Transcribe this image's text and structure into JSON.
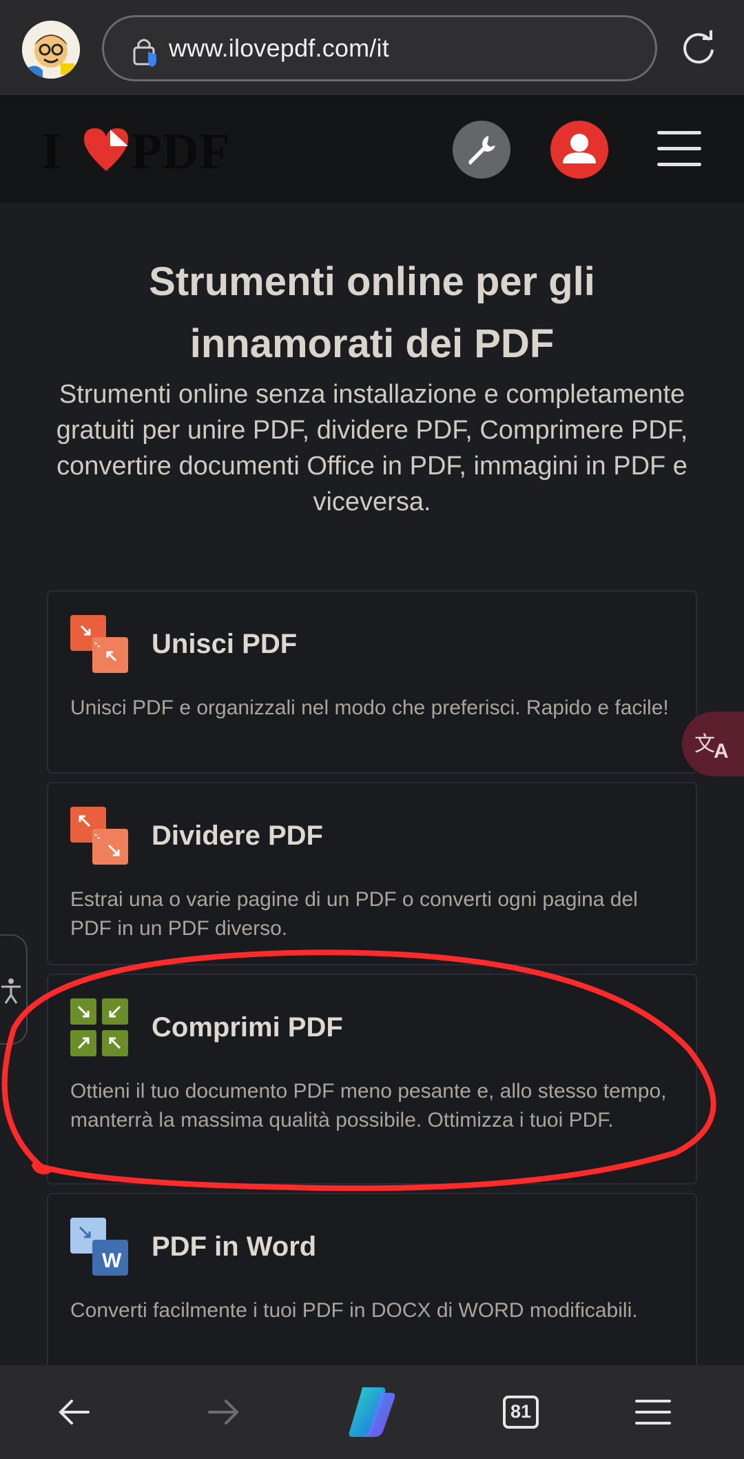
{
  "browser": {
    "url": "www.ilovepdf.com/it",
    "tab_count": "81"
  },
  "header": {
    "logo_text": "I ♥ PDF"
  },
  "hero": {
    "title_line1": "Strumenti online per gli",
    "title_line2": "innamorati dei PDF",
    "subtitle": "Strumenti online senza installazione e completamente gratuiti per unire PDF, dividere PDF, Comprimere PDF, convertire documenti Office in PDF, immagini in PDF e viceversa."
  },
  "tools": [
    {
      "title": "Unisci PDF",
      "description": "Unisci PDF e organizzali nel modo che preferisci. Rapido e facile!",
      "icon": "merge-pdf-icon",
      "color": "#e8613c"
    },
    {
      "title": "Dividere PDF",
      "description": "Estrai una o varie pagine di un PDF o converti ogni pagina del PDF in un PDF diverso.",
      "icon": "split-pdf-icon",
      "color": "#e8613c"
    },
    {
      "title": "Comprimi PDF",
      "description": "Ottieni il tuo documento PDF meno pesante e, allo stesso tempo, manterrà la massima qualità possibile. Ottimizza i tuoi PDF.",
      "icon": "compress-pdf-icon",
      "color": "#6b8e2a"
    },
    {
      "title": "PDF in Word",
      "description": "Converti facilmente i tuoi PDF in DOCX di WORD modificabili.",
      "icon": "pdf-to-word-icon",
      "color": "#3f6fb0"
    }
  ],
  "colors": {
    "brand_red": "#e5322d",
    "annotation_red": "#ff2b2b"
  }
}
